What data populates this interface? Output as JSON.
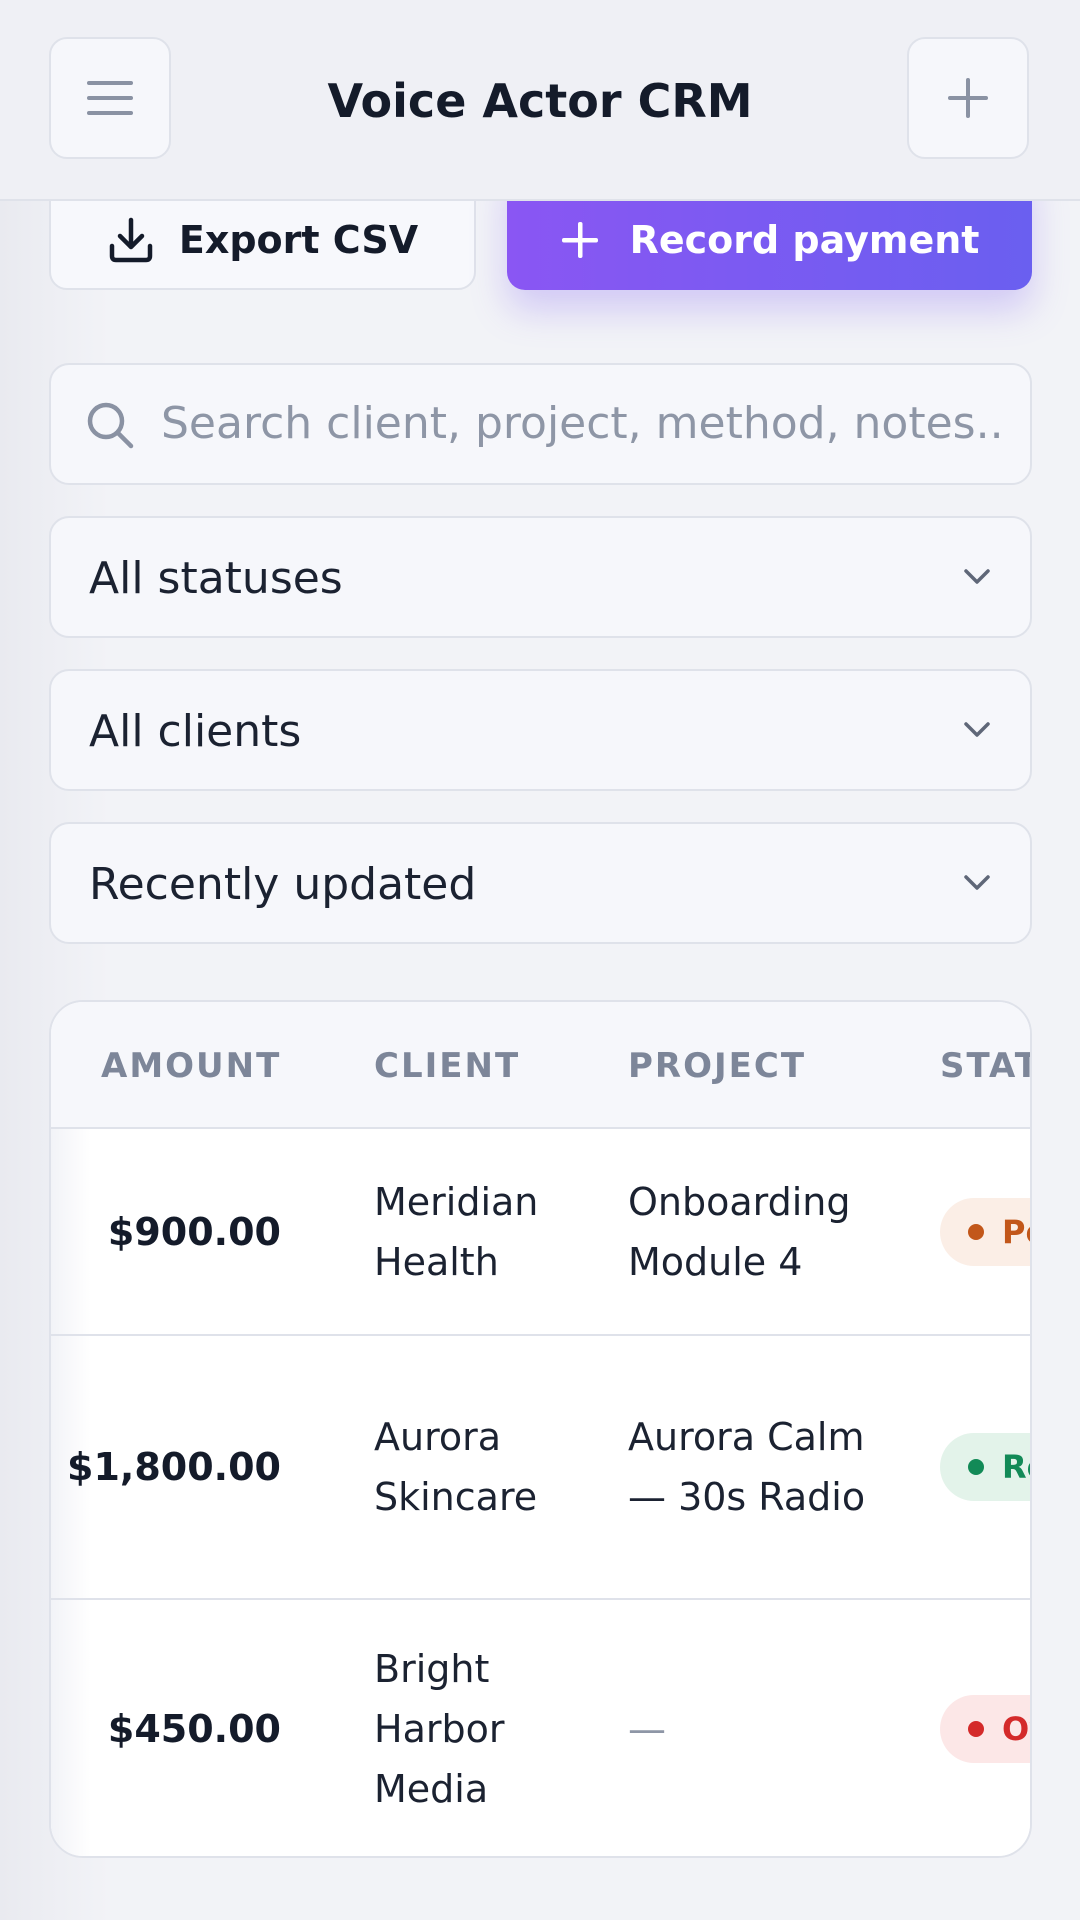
{
  "header": {
    "title": "Voice Actor CRM",
    "menu_icon": "hamburger-menu-icon",
    "add_icon": "plus-icon"
  },
  "actions": {
    "export_label": "Export CSV",
    "record_label": "Record payment"
  },
  "search": {
    "placeholder": "Search client, project, method, notes.."
  },
  "filters": {
    "status": "All statuses",
    "client": "All clients",
    "sort": "Recently updated"
  },
  "table": {
    "columns": [
      "AMOUNT",
      "CLIENT",
      "PROJECT",
      "STATU"
    ],
    "rows": [
      {
        "amount": "$900.00",
        "client": "Meridian Health",
        "project": "Onboarding Module 4",
        "status": "Pe",
        "status_color": "#c2571a",
        "status_bg": "#fbeee6"
      },
      {
        "amount": "$1,800.00",
        "client": "Aurora Skincare",
        "project": "Aurora Calm — 30s Radio",
        "status": "Re",
        "status_color": "#128a57",
        "status_bg": "#e3f3ea"
      },
      {
        "amount": "$450.00",
        "client": "Bright Harbor Media",
        "project": "—",
        "status": "Ov",
        "status_color": "#d42a2a",
        "status_bg": "#fce7e7"
      }
    ]
  },
  "colors": {
    "accent_start": "#8a56f3",
    "accent_end": "#6a5ff0"
  }
}
